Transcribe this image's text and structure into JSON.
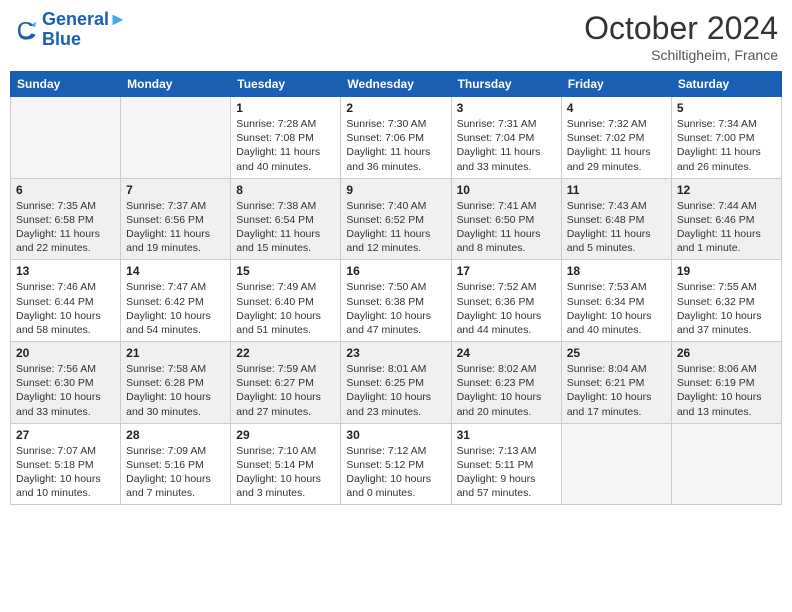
{
  "header": {
    "logo_line1": "General",
    "logo_line2": "Blue",
    "month": "October 2024",
    "location": "Schiltigheim, France"
  },
  "weekdays": [
    "Sunday",
    "Monday",
    "Tuesday",
    "Wednesday",
    "Thursday",
    "Friday",
    "Saturday"
  ],
  "weeks": [
    [
      {
        "day": "",
        "info": ""
      },
      {
        "day": "",
        "info": ""
      },
      {
        "day": "1",
        "info": "Sunrise: 7:28 AM\nSunset: 7:08 PM\nDaylight: 11 hours and 40 minutes."
      },
      {
        "day": "2",
        "info": "Sunrise: 7:30 AM\nSunset: 7:06 PM\nDaylight: 11 hours and 36 minutes."
      },
      {
        "day": "3",
        "info": "Sunrise: 7:31 AM\nSunset: 7:04 PM\nDaylight: 11 hours and 33 minutes."
      },
      {
        "day": "4",
        "info": "Sunrise: 7:32 AM\nSunset: 7:02 PM\nDaylight: 11 hours and 29 minutes."
      },
      {
        "day": "5",
        "info": "Sunrise: 7:34 AM\nSunset: 7:00 PM\nDaylight: 11 hours and 26 minutes."
      }
    ],
    [
      {
        "day": "6",
        "info": "Sunrise: 7:35 AM\nSunset: 6:58 PM\nDaylight: 11 hours and 22 minutes."
      },
      {
        "day": "7",
        "info": "Sunrise: 7:37 AM\nSunset: 6:56 PM\nDaylight: 11 hours and 19 minutes."
      },
      {
        "day": "8",
        "info": "Sunrise: 7:38 AM\nSunset: 6:54 PM\nDaylight: 11 hours and 15 minutes."
      },
      {
        "day": "9",
        "info": "Sunrise: 7:40 AM\nSunset: 6:52 PM\nDaylight: 11 hours and 12 minutes."
      },
      {
        "day": "10",
        "info": "Sunrise: 7:41 AM\nSunset: 6:50 PM\nDaylight: 11 hours and 8 minutes."
      },
      {
        "day": "11",
        "info": "Sunrise: 7:43 AM\nSunset: 6:48 PM\nDaylight: 11 hours and 5 minutes."
      },
      {
        "day": "12",
        "info": "Sunrise: 7:44 AM\nSunset: 6:46 PM\nDaylight: 11 hours and 1 minute."
      }
    ],
    [
      {
        "day": "13",
        "info": "Sunrise: 7:46 AM\nSunset: 6:44 PM\nDaylight: 10 hours and 58 minutes."
      },
      {
        "day": "14",
        "info": "Sunrise: 7:47 AM\nSunset: 6:42 PM\nDaylight: 10 hours and 54 minutes."
      },
      {
        "day": "15",
        "info": "Sunrise: 7:49 AM\nSunset: 6:40 PM\nDaylight: 10 hours and 51 minutes."
      },
      {
        "day": "16",
        "info": "Sunrise: 7:50 AM\nSunset: 6:38 PM\nDaylight: 10 hours and 47 minutes."
      },
      {
        "day": "17",
        "info": "Sunrise: 7:52 AM\nSunset: 6:36 PM\nDaylight: 10 hours and 44 minutes."
      },
      {
        "day": "18",
        "info": "Sunrise: 7:53 AM\nSunset: 6:34 PM\nDaylight: 10 hours and 40 minutes."
      },
      {
        "day": "19",
        "info": "Sunrise: 7:55 AM\nSunset: 6:32 PM\nDaylight: 10 hours and 37 minutes."
      }
    ],
    [
      {
        "day": "20",
        "info": "Sunrise: 7:56 AM\nSunset: 6:30 PM\nDaylight: 10 hours and 33 minutes."
      },
      {
        "day": "21",
        "info": "Sunrise: 7:58 AM\nSunset: 6:28 PM\nDaylight: 10 hours and 30 minutes."
      },
      {
        "day": "22",
        "info": "Sunrise: 7:59 AM\nSunset: 6:27 PM\nDaylight: 10 hours and 27 minutes."
      },
      {
        "day": "23",
        "info": "Sunrise: 8:01 AM\nSunset: 6:25 PM\nDaylight: 10 hours and 23 minutes."
      },
      {
        "day": "24",
        "info": "Sunrise: 8:02 AM\nSunset: 6:23 PM\nDaylight: 10 hours and 20 minutes."
      },
      {
        "day": "25",
        "info": "Sunrise: 8:04 AM\nSunset: 6:21 PM\nDaylight: 10 hours and 17 minutes."
      },
      {
        "day": "26",
        "info": "Sunrise: 8:06 AM\nSunset: 6:19 PM\nDaylight: 10 hours and 13 minutes."
      }
    ],
    [
      {
        "day": "27",
        "info": "Sunrise: 7:07 AM\nSunset: 5:18 PM\nDaylight: 10 hours and 10 minutes."
      },
      {
        "day": "28",
        "info": "Sunrise: 7:09 AM\nSunset: 5:16 PM\nDaylight: 10 hours and 7 minutes."
      },
      {
        "day": "29",
        "info": "Sunrise: 7:10 AM\nSunset: 5:14 PM\nDaylight: 10 hours and 3 minutes."
      },
      {
        "day": "30",
        "info": "Sunrise: 7:12 AM\nSunset: 5:12 PM\nDaylight: 10 hours and 0 minutes."
      },
      {
        "day": "31",
        "info": "Sunrise: 7:13 AM\nSunset: 5:11 PM\nDaylight: 9 hours and 57 minutes."
      },
      {
        "day": "",
        "info": ""
      },
      {
        "day": "",
        "info": ""
      }
    ]
  ]
}
